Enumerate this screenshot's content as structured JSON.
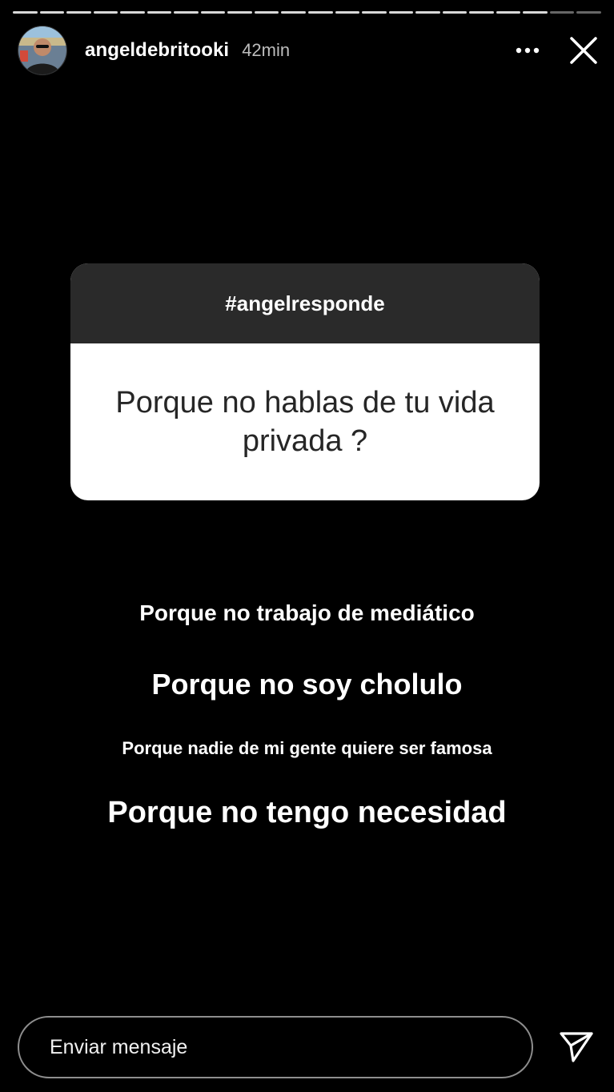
{
  "story": {
    "progress_segments_total": 22,
    "progress_segments_viewed": 20
  },
  "header": {
    "username": "angeldebritooki",
    "time": "42min",
    "avatar_icon": "profile-avatar",
    "more_icon": "more-horizontal-icon",
    "close_icon": "close-icon"
  },
  "question_sticker": {
    "header": "#angelresponde",
    "question": "Porque no hablas de tu vida privada ?",
    "header_color": "#2a2a2a",
    "body_color": "#ffffff"
  },
  "answers": [
    "Porque no trabajo de mediático",
    "Porque no soy cholulo",
    "Porque nadie de mi gente quiere ser famosa",
    "Porque no tengo necesidad"
  ],
  "footer": {
    "message_placeholder": "Enviar mensaje",
    "send_icon": "send-icon"
  }
}
